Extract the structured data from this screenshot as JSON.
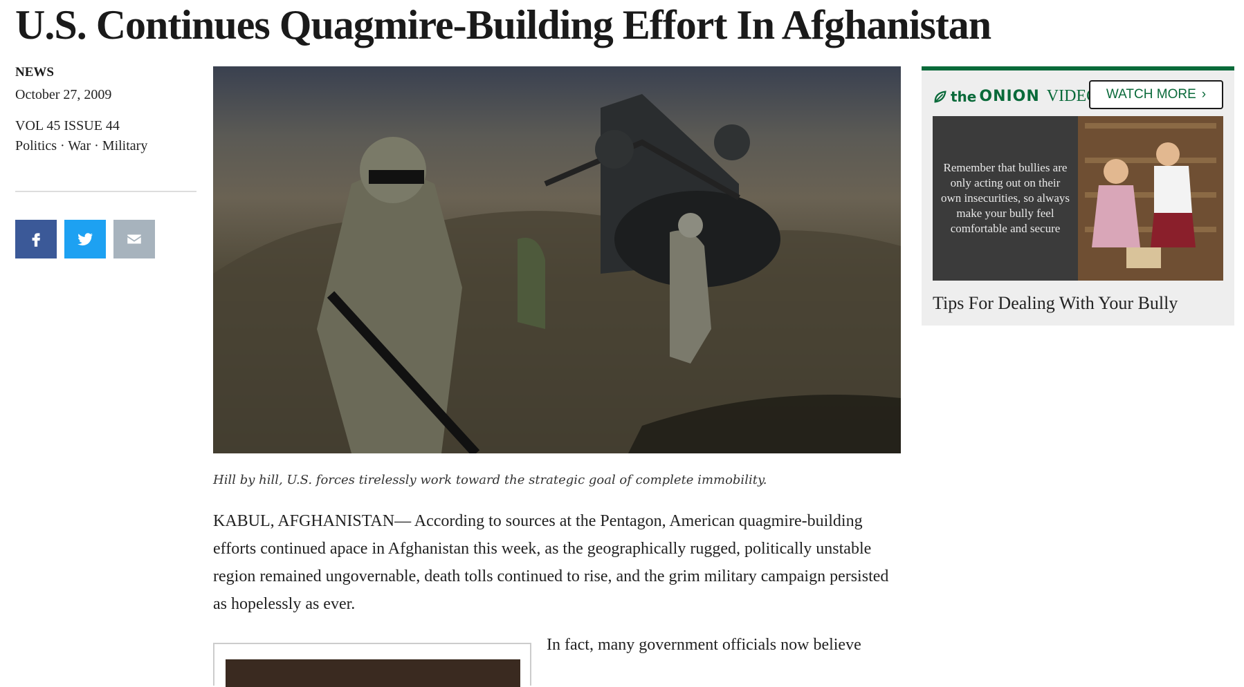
{
  "article": {
    "headline": "U.S. Continues Quagmire-Building Effort In Afghanistan",
    "section": "NEWS",
    "date": "October 27, 2009",
    "issue": "VOL 45 ISSUE 44",
    "tags": "Politics · War · Military",
    "caption": "Hill by hill, U.S. forces tirelessly work toward the strategic goal of complete immobility.",
    "paragraph1": "KABUL, AFGHANISTAN— According to sources at the Pentagon, American quagmire-building efforts continued apace in Afghanistan this week, as the geographically rugged, politically unstable region remained ungovernable, death tolls continued to rise, and the grim military campaign persisted as hopelessly as ever.",
    "paragraph2_start": "In fact, many government officials now believe"
  },
  "share": [
    {
      "icon": "facebook-icon",
      "color": "#3b5998"
    },
    {
      "icon": "twitter-icon",
      "color": "#1da1f2"
    },
    {
      "icon": "email-icon",
      "color": "#a7b3bd"
    }
  ],
  "sidebar": {
    "brand_the": "the",
    "brand_onion": "ONION",
    "brand_video": "VIDEO",
    "watch_more_label": "WATCH MORE",
    "watch_more_icon": "chevron-right-icon",
    "thumb_text": "Remember that bullies are only acting out on their own insecurities, so always make your bully feel comfortable and secure",
    "video_title": "Tips For Dealing With Your Bully",
    "accent_color": "#0a6a3a"
  }
}
